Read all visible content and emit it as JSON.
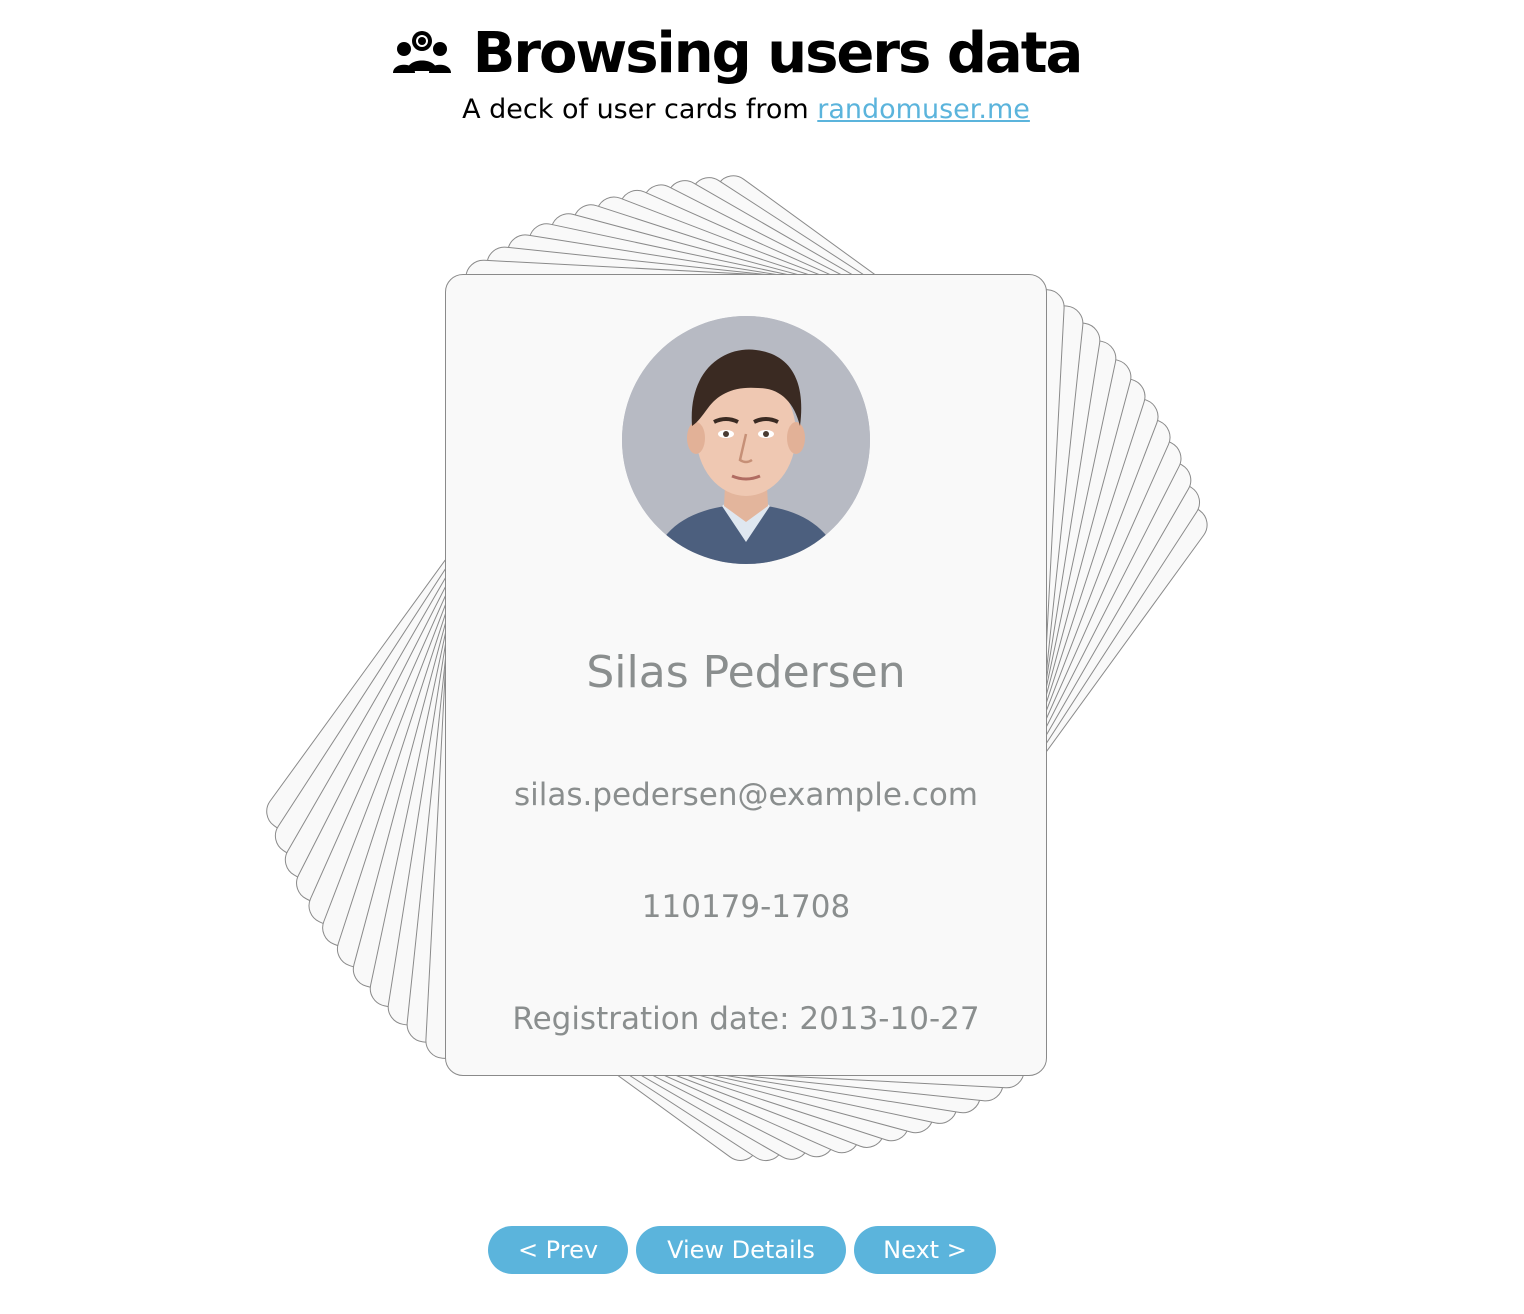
{
  "header": {
    "icon": "users-group-icon",
    "title": "Browsing users data",
    "subtitle_prefix": "A deck of user cards from ",
    "subtitle_link": "randomuser.me"
  },
  "user": {
    "name": "Silas Pedersen",
    "email": "silas.pedersen@example.com",
    "phone": "110179-1708",
    "registration": "Registration date: 2013-10-27",
    "avatar_icon": "user-photo"
  },
  "controls": {
    "prev_label": "< Prev",
    "details_label": "View Details",
    "next_label": "Next >"
  },
  "colors": {
    "accent": "#5bb4dc",
    "card_border": "#8a8a8a",
    "card_bg": "#f9f9f9",
    "muted_text": "#8a8e8e"
  }
}
